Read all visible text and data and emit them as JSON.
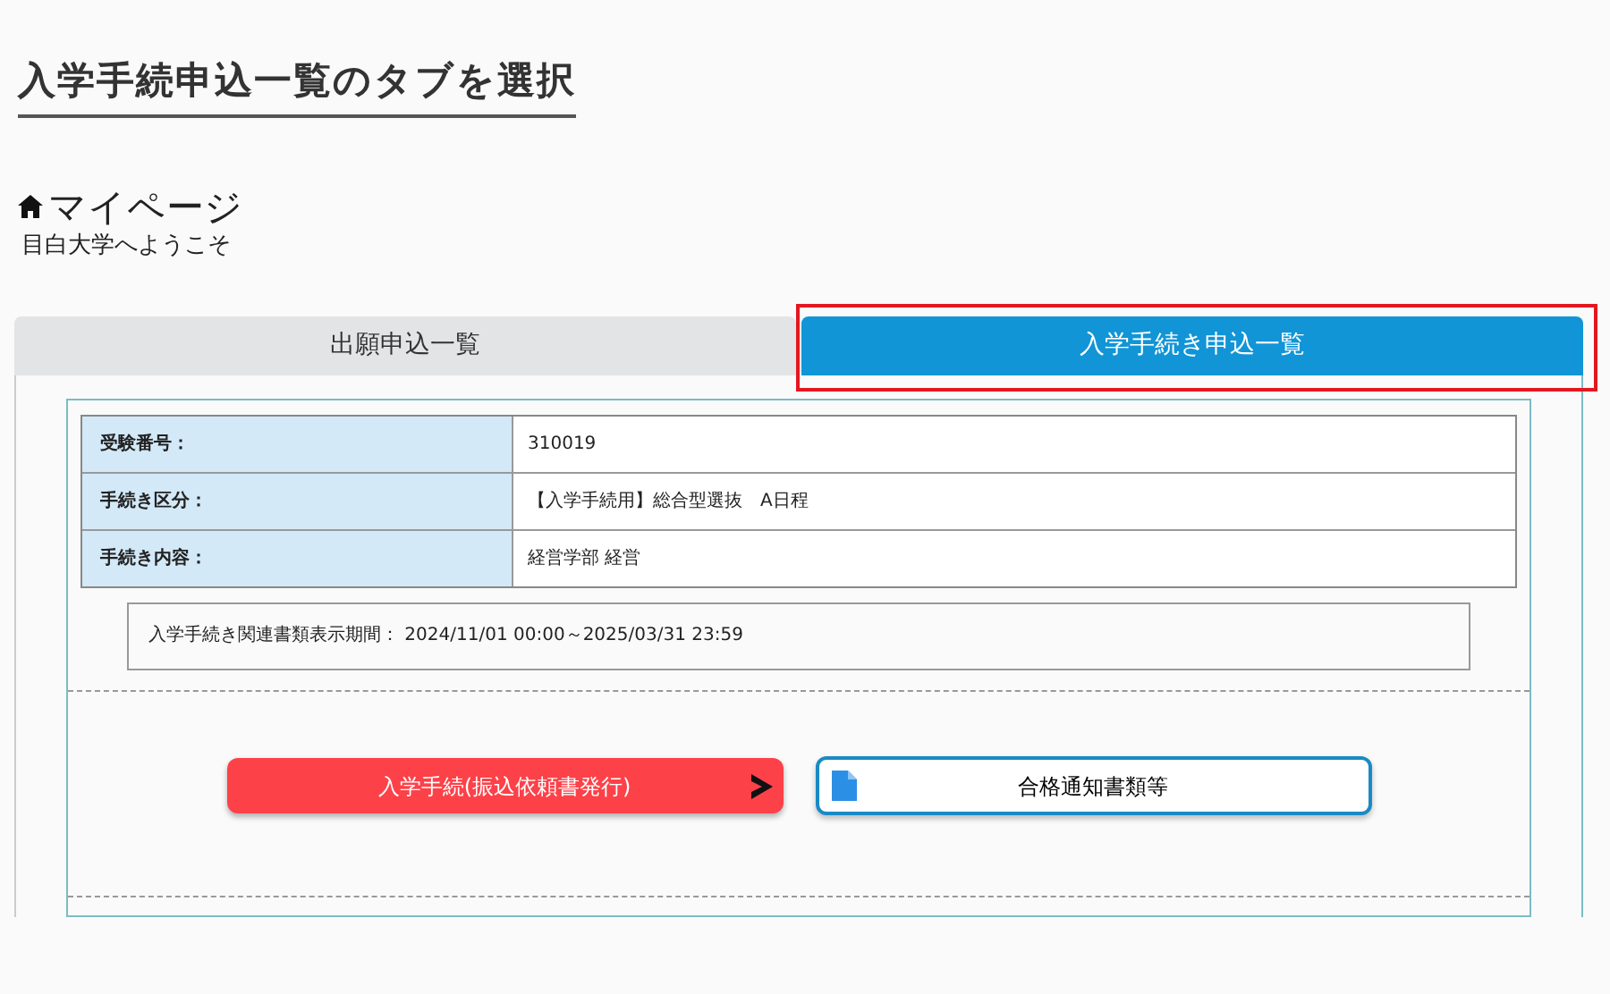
{
  "heading": "入学手続申込一覧のタブを選択",
  "page": {
    "title": "マイページ",
    "welcome": "目白大学へようこそ"
  },
  "tabs": [
    {
      "label": "出願申込一覧",
      "selected": false
    },
    {
      "label": "入学手続き申込一覧",
      "selected": true
    }
  ],
  "details": [
    {
      "label": "受験番号：",
      "value": "310019"
    },
    {
      "label": "手続き区分：",
      "value": "【入学手続用】総合型選抜　A日程"
    },
    {
      "label": "手続き内容：",
      "value": "経営学部 経営"
    }
  ],
  "period": "入学手続き関連書類表示期間： 2024/11/01 00:00～2025/03/31 23:59",
  "buttons": [
    {
      "kind": "primary",
      "label": "入学手続(振込依頼書発行)"
    },
    {
      "kind": "document",
      "label": "合格通知書類等"
    }
  ]
}
